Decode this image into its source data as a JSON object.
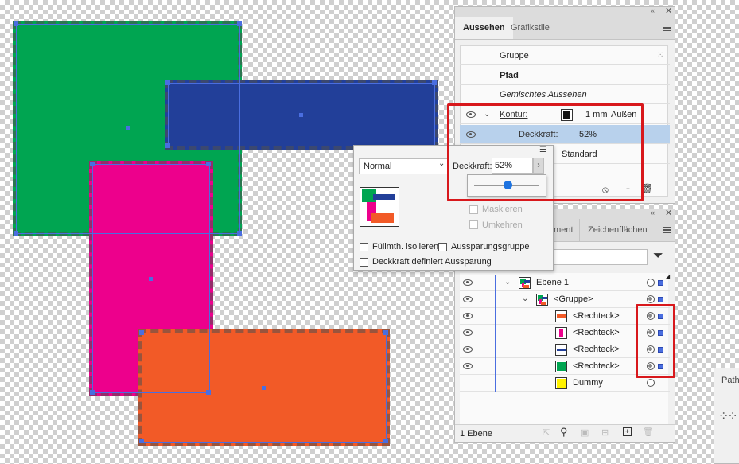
{
  "appearance_panel": {
    "tabs": [
      "Aussehen",
      "Grafikstile"
    ],
    "header_rows": [
      "Gruppe",
      "Pfad",
      "Gemischtes Aussehen"
    ],
    "kontur": {
      "label": "Kontur:",
      "value": "1 mm",
      "align": "Außen"
    },
    "deckkraft": {
      "label": "Deckkraft:",
      "value": "52%"
    },
    "mode_value": "Standard"
  },
  "transparency_popup": {
    "blend_mode": "Normal",
    "opacity_label": "Deckkraft:",
    "opacity_value": "52%",
    "slider_value": 0.52,
    "mask_options": [
      "Maskieren",
      "Umkehren"
    ],
    "checkboxes": [
      "Füllmth. isolieren",
      "Aussparungsgruppe",
      "Deckkraft definiert Aussparung"
    ]
  },
  "layers_panel": {
    "tabs": [
      "ement",
      "Zeichenflächen"
    ],
    "rows": [
      {
        "label": "Ebene 1",
        "indent": 0,
        "twisty": true
      },
      {
        "label": "<Gruppe>",
        "indent": 1,
        "twisty": true
      },
      {
        "label": "<Rechteck>",
        "indent": 2,
        "thumb": "#f25a27"
      },
      {
        "label": "<Rechteck>",
        "indent": 2,
        "thumb": "#ed008c"
      },
      {
        "label": "<Rechteck>",
        "indent": 2,
        "thumb": "#223f99"
      },
      {
        "label": "<Rechteck>",
        "indent": 2,
        "thumb": "#00a551"
      },
      {
        "label": "Dummy",
        "indent": 2,
        "thumb": "#fff200"
      }
    ],
    "footer_label": "1 Ebene"
  },
  "side_panel": {
    "tab_label": "Path"
  },
  "colors": {
    "green": "#00a551",
    "blue": "#223f99",
    "magenta": "#ed008c",
    "orange": "#f25a27",
    "selection": "#4a6ee0",
    "highlight": "#d8181c"
  }
}
